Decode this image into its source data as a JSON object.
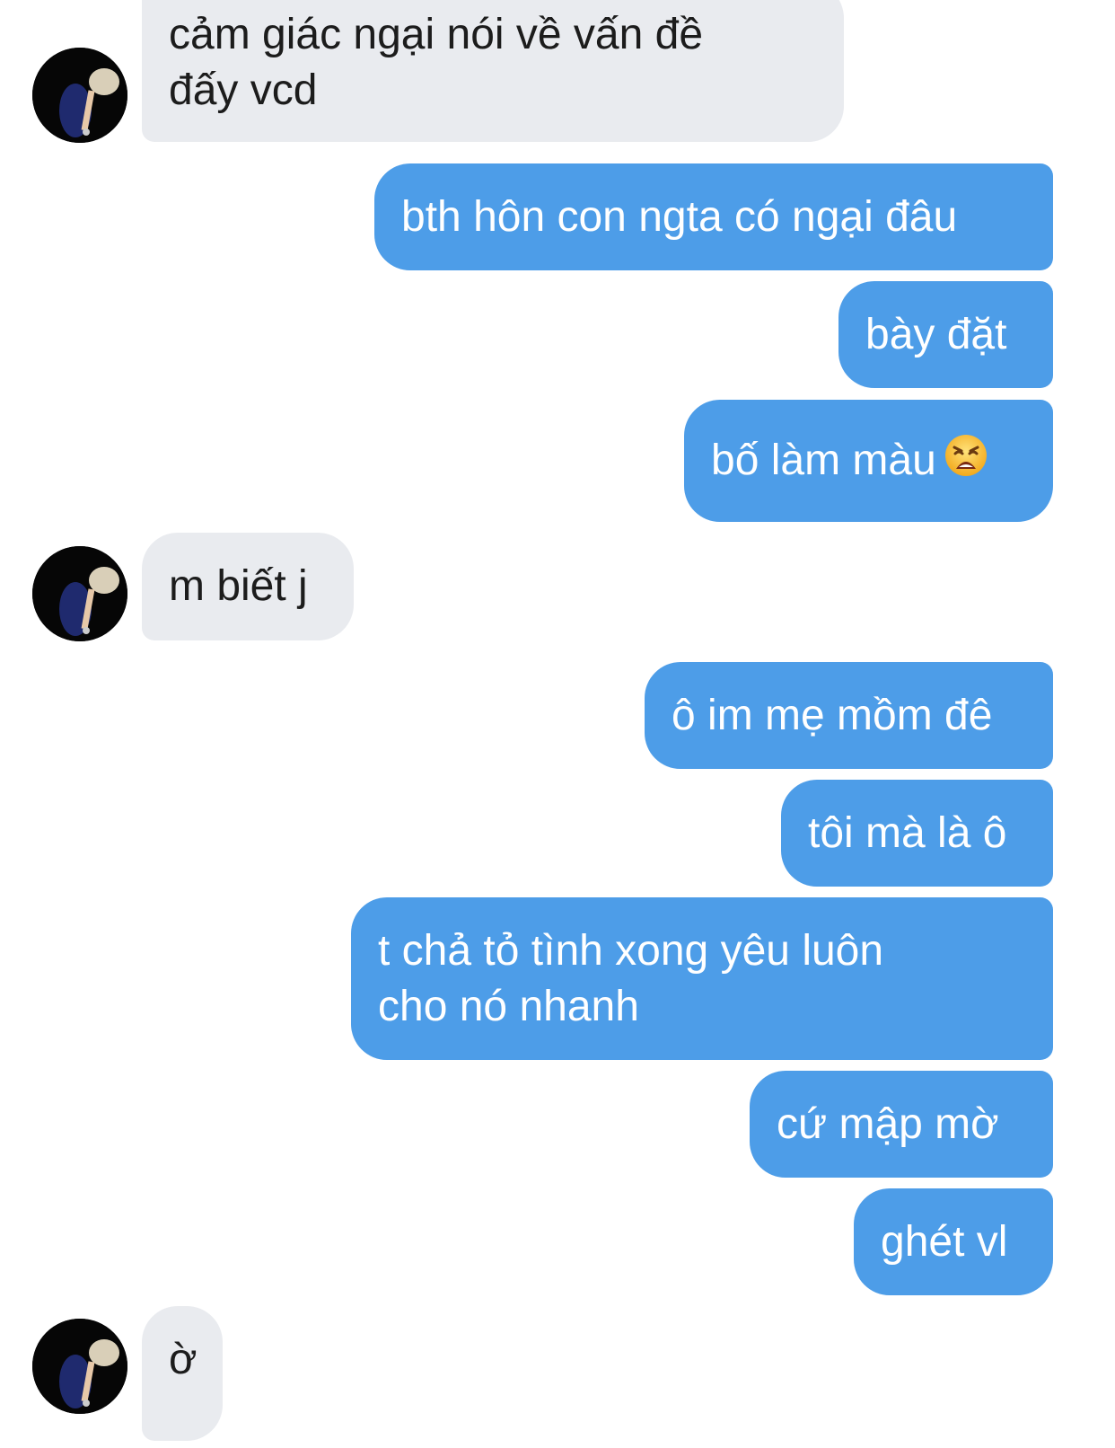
{
  "conversation": {
    "messages": [
      {
        "sender": "them",
        "text": "cảm giác ngại nói về vấn đề\nđấy vcd"
      },
      {
        "sender": "me",
        "text": "bth hôn con ngta có ngại đâu"
      },
      {
        "sender": "me",
        "text": "bày đặt"
      },
      {
        "sender": "me",
        "text": "bố làm màu",
        "emoji": "weary-face-emoji"
      },
      {
        "sender": "them",
        "text": "m biết j"
      },
      {
        "sender": "me",
        "text": "ô im mẹ mồm đê"
      },
      {
        "sender": "me",
        "text": "tôi mà là ô"
      },
      {
        "sender": "me",
        "text": "t chả tỏ tình xong yêu luôn\ncho nó nhanh"
      },
      {
        "sender": "me",
        "text": "cứ mập mờ"
      },
      {
        "sender": "me",
        "text": "ghét vl"
      },
      {
        "sender": "them",
        "text": "ờ"
      }
    ]
  },
  "theme": {
    "incoming_bubble_color": "#e9ebef",
    "outgoing_bubble_color": "#4d9de8",
    "outgoing_text_color": "#ffffff",
    "incoming_text_color": "#1c1c1c",
    "background": "#ffffff"
  },
  "icons": {
    "avatar": "contact-avatar-photo",
    "emoji": "weary-face-emoji"
  }
}
